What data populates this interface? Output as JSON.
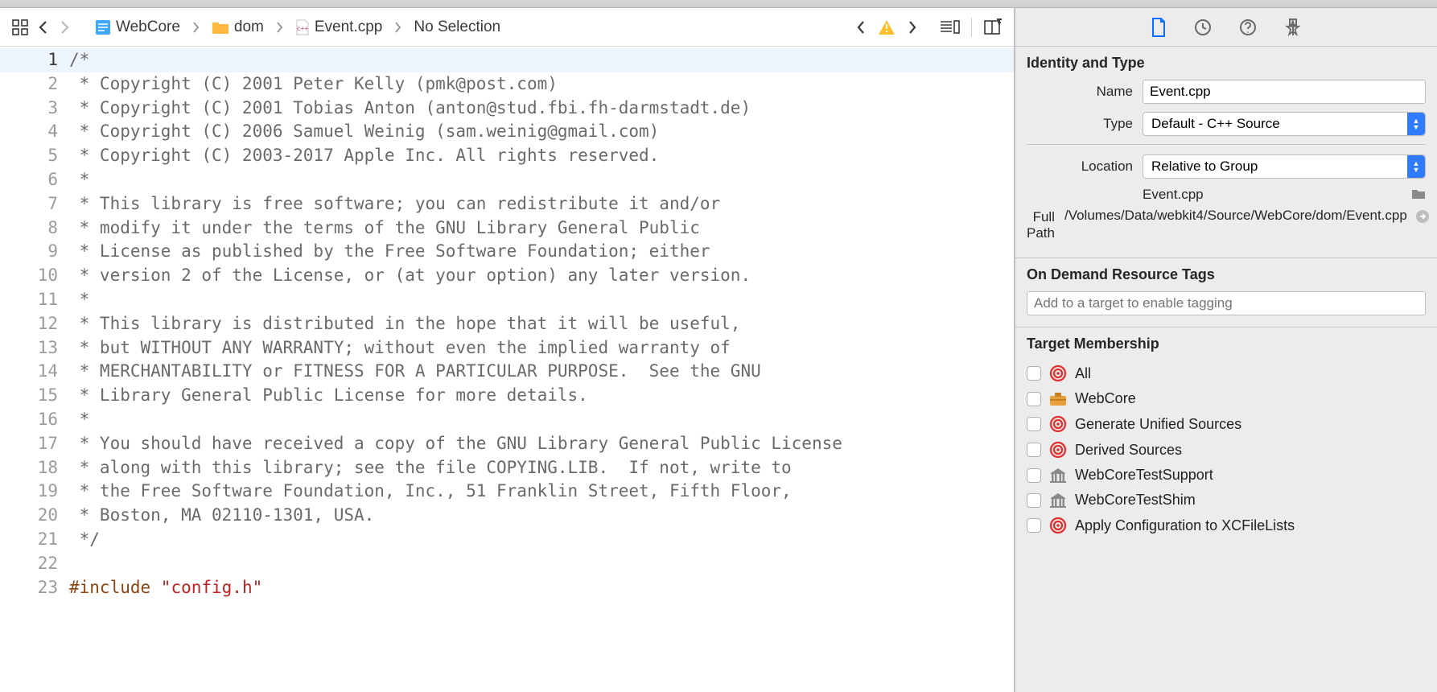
{
  "breadcrumb": {
    "project": "WebCore",
    "folder": "dom",
    "file": "Event.cpp",
    "selection": "No Selection"
  },
  "code": {
    "lines": [
      "/*",
      " * Copyright (C) 2001 Peter Kelly (pmk@post.com)",
      " * Copyright (C) 2001 Tobias Anton (anton@stud.fbi.fh-darmstadt.de)",
      " * Copyright (C) 2006 Samuel Weinig (sam.weinig@gmail.com)",
      " * Copyright (C) 2003-2017 Apple Inc. All rights reserved.",
      " *",
      " * This library is free software; you can redistribute it and/or",
      " * modify it under the terms of the GNU Library General Public",
      " * License as published by the Free Software Foundation; either",
      " * version 2 of the License, or (at your option) any later version.",
      " *",
      " * This library is distributed in the hope that it will be useful,",
      " * but WITHOUT ANY WARRANTY; without even the implied warranty of",
      " * MERCHANTABILITY or FITNESS FOR A PARTICULAR PURPOSE.  See the GNU",
      " * Library General Public License for more details.",
      " *",
      " * You should have received a copy of the GNU Library General Public License",
      " * along with this library; see the file COPYING.LIB.  If not, write to",
      " * the Free Software Foundation, Inc., 51 Franklin Street, Fifth Floor,",
      " * Boston, MA 02110-1301, USA.",
      " */",
      "",
      "#include \"config.h\""
    ],
    "include_directive": "#include",
    "include_arg": "\"config.h\""
  },
  "inspector": {
    "identity": {
      "heading": "Identity and Type",
      "name_label": "Name",
      "name_value": "Event.cpp",
      "type_label": "Type",
      "type_value": "Default - C++ Source",
      "location_label": "Location",
      "location_value": "Relative to Group",
      "location_file": "Event.cpp",
      "fullpath_label": "Full Path",
      "fullpath_value": "/Volumes/Data/webkit4/Source/WebCore/dom/Event.cpp"
    },
    "resource_tags": {
      "heading": "On Demand Resource Tags",
      "placeholder": "Add to a target to enable tagging"
    },
    "target_membership": {
      "heading": "Target Membership",
      "items": [
        {
          "icon": "target",
          "label": "All"
        },
        {
          "icon": "toolbox",
          "label": "WebCore"
        },
        {
          "icon": "target",
          "label": "Generate Unified Sources"
        },
        {
          "icon": "target",
          "label": "Derived Sources"
        },
        {
          "icon": "building",
          "label": "WebCoreTestSupport"
        },
        {
          "icon": "building",
          "label": "WebCoreTestShim"
        },
        {
          "icon": "target",
          "label": "Apply Configuration to XCFileLists"
        }
      ]
    }
  }
}
